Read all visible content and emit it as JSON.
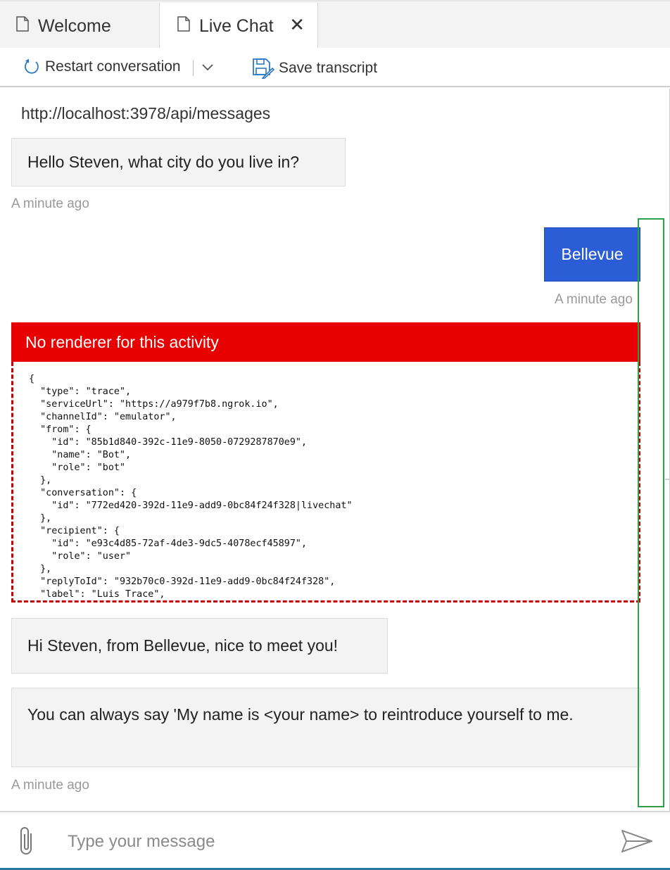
{
  "tabs": [
    {
      "label": "Welcome",
      "active": false
    },
    {
      "label": "Live Chat",
      "active": true,
      "close": "✕"
    }
  ],
  "toolbar": {
    "restart_label": "Restart conversation",
    "save_label": "Save transcript"
  },
  "chat": {
    "endpoint": "http://localhost:3978/api/messages",
    "messages": [
      {
        "from": "bot",
        "text": "Hello Steven, what city do you live in?",
        "timestamp": "A minute ago"
      },
      {
        "from": "user",
        "text": "Bellevue",
        "timestamp": "A minute ago"
      },
      {
        "from": "bot",
        "type": "error",
        "header": "No renderer for this activity",
        "json": "{\n  \"type\": \"trace\",\n  \"serviceUrl\": \"https://a979f7b8.ngrok.io\",\n  \"channelId\": \"emulator\",\n  \"from\": {\n    \"id\": \"85b1d840-392c-11e9-8050-0729287870e9\",\n    \"name\": \"Bot\",\n    \"role\": \"bot\"\n  },\n  \"conversation\": {\n    \"id\": \"772ed420-392d-11e9-add9-0bc84f24f328|livechat\"\n  },\n  \"recipient\": {\n    \"id\": \"e93c4d85-72af-4de3-9dc5-4078ecf45897\",\n    \"role\": \"user\"\n  },\n  \"replyToId\": \"932b70c0-392d-11e9-add9-0bc84f24f328\",\n  \"label\": \"Luis Trace\","
      },
      {
        "from": "bot",
        "text": "Hi Steven, from Bellevue, nice to meet you!"
      },
      {
        "from": "bot",
        "text": "You can always say 'My name is <your name> to reintroduce yourself to me.",
        "timestamp": "A minute ago"
      }
    ]
  },
  "input": {
    "placeholder": "Type your message"
  },
  "colors": {
    "user_bubble": "#2b5dd6",
    "error_header": "#e80000",
    "error_border": "#c40000",
    "highlight": "#2e9e4a"
  }
}
